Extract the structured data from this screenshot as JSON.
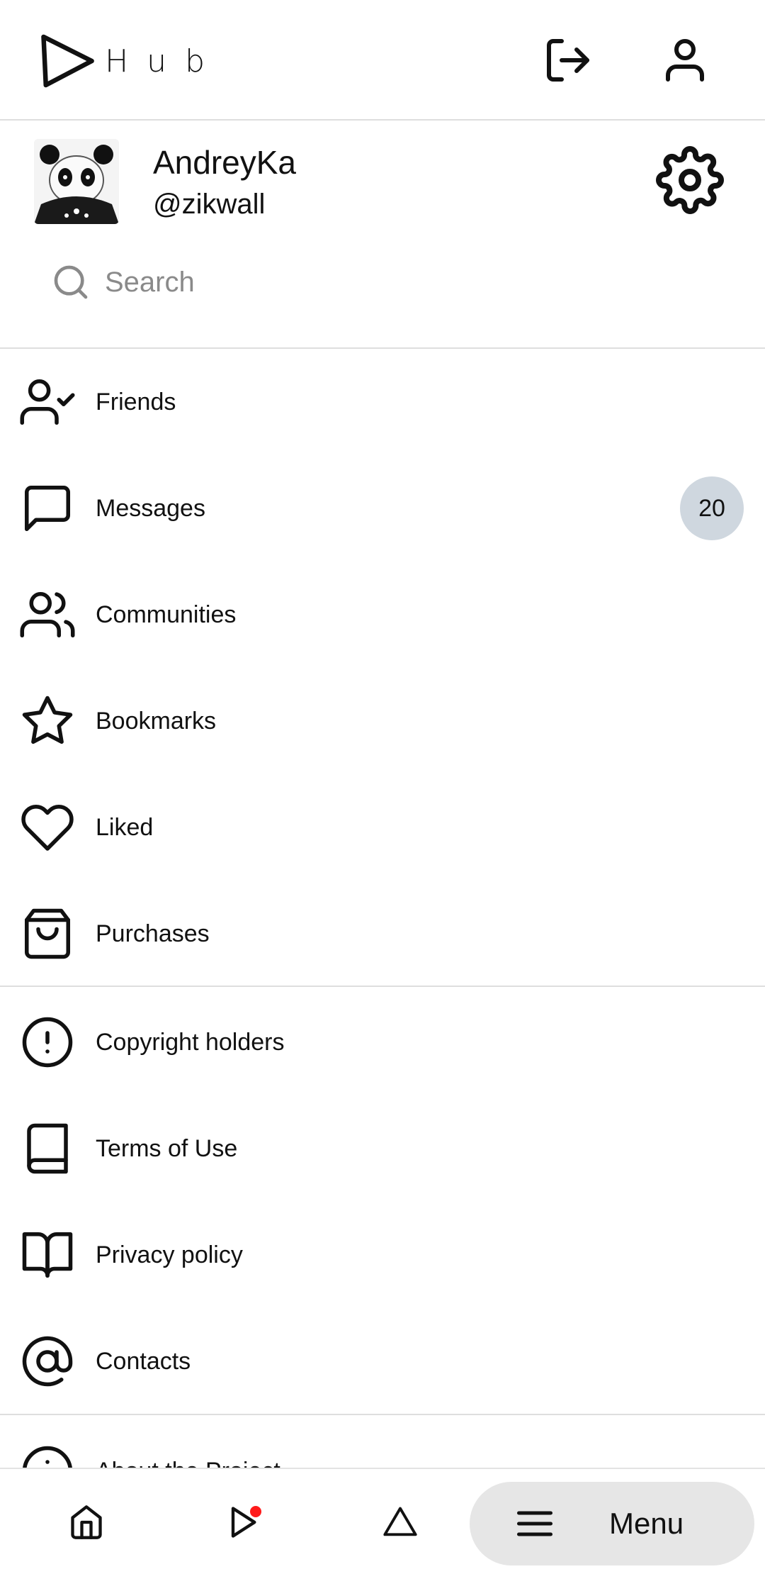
{
  "app": {
    "logo_text": "Hub",
    "logout_icon": "logout-icon",
    "account_icon": "user-icon"
  },
  "profile": {
    "name": "AndreyKa",
    "handle": "@zikwall",
    "avatar": "panda-avatar",
    "settings_icon": "gear-icon"
  },
  "search": {
    "placeholder": "Search",
    "value": ""
  },
  "menu": {
    "primary": [
      {
        "label": "Friends",
        "icon": "user-check-icon"
      },
      {
        "label": "Messages",
        "icon": "message-square-icon",
        "badge": "20"
      },
      {
        "label": "Communities",
        "icon": "users-icon"
      },
      {
        "label": "Bookmarks",
        "icon": "star-icon"
      },
      {
        "label": "Liked",
        "icon": "heart-icon"
      },
      {
        "label": "Purchases",
        "icon": "shopping-bag-icon"
      }
    ],
    "secondary": [
      {
        "label": "Copyright holders",
        "icon": "alert-circle-icon"
      },
      {
        "label": "Terms of Use",
        "icon": "book-icon"
      },
      {
        "label": "Privacy policy",
        "icon": "book-open-icon"
      },
      {
        "label": "Contacts",
        "icon": "at-sign-icon"
      }
    ],
    "tertiary": [
      {
        "label": "About the Project",
        "icon": "info-icon"
      }
    ]
  },
  "bottom_nav": {
    "home_icon": "home-icon",
    "play_icon": "play-icon",
    "triangle_icon": "triangle-icon",
    "menu_label": "Menu",
    "menu_icon": "hamburger-icon",
    "notification_color": "#ff1a1a"
  },
  "colors": {
    "badge_bg": "#cfd7df",
    "divider": "#dedede",
    "pill_bg": "#e6e6e6"
  }
}
